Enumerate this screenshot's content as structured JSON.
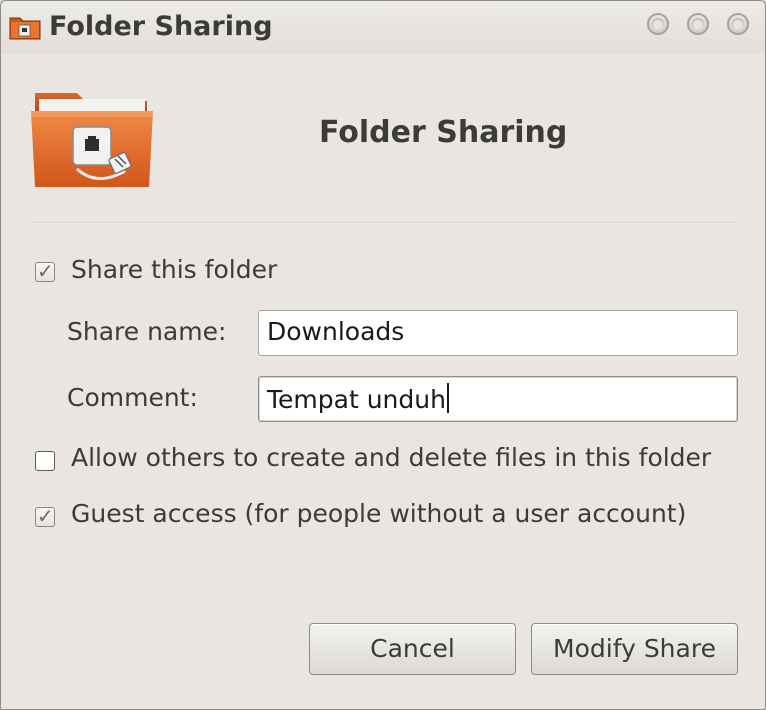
{
  "window": {
    "title": "Folder Sharing"
  },
  "header": {
    "title": "Folder Sharing",
    "icon": "folder-share-icon"
  },
  "share_this_folder": {
    "label": "Share this folder",
    "checked": true
  },
  "share_name": {
    "label": "Share name:",
    "value": "Downloads"
  },
  "comment": {
    "label": "Comment:",
    "value": "Tempat unduh"
  },
  "allow_others": {
    "label": "Allow others to create and delete files in this folder",
    "checked": false
  },
  "guest_access": {
    "label": "Guest access (for people without a user account)",
    "checked": true
  },
  "buttons": {
    "cancel": "Cancel",
    "modify": "Modify Share"
  },
  "colors": {
    "accent": "#dd4814",
    "background": "#e9e6e1"
  }
}
